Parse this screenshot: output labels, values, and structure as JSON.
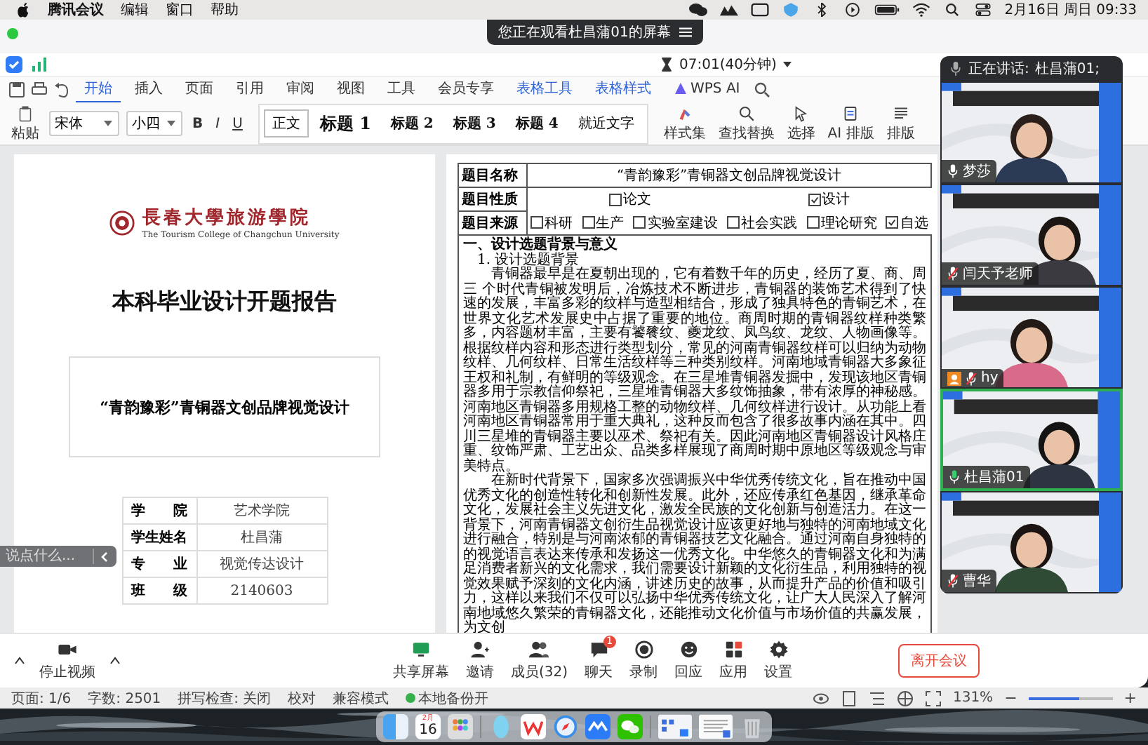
{
  "menubar": {
    "app": "腾讯会议",
    "menus": [
      "编辑",
      "窗口",
      "帮助"
    ],
    "clock": "2月16日 周日 09:33"
  },
  "share_banner": "您正在观看杜昌蒲01的屏幕",
  "meeting_timer": "07:01(40分钟)",
  "ribbon": {
    "tabs": [
      {
        "label": "开始",
        "selected": true,
        "kind": "normal"
      },
      {
        "label": "插入",
        "selected": false,
        "kind": "normal"
      },
      {
        "label": "页面",
        "selected": false,
        "kind": "normal"
      },
      {
        "label": "引用",
        "selected": false,
        "kind": "normal"
      },
      {
        "label": "审阅",
        "selected": false,
        "kind": "normal"
      },
      {
        "label": "视图",
        "selected": false,
        "kind": "normal"
      },
      {
        "label": "工具",
        "selected": false,
        "kind": "normal"
      },
      {
        "label": "会员专享",
        "selected": false,
        "kind": "normal"
      },
      {
        "label": "表格工具",
        "selected": false,
        "kind": "contextual"
      },
      {
        "label": "表格样式",
        "selected": false,
        "kind": "contextual"
      },
      {
        "label": "WPS AI",
        "selected": false,
        "kind": "ai"
      }
    ],
    "paste": "粘贴",
    "font": "宋体",
    "size": "小四",
    "format_buttons": [
      "B",
      "I",
      "U"
    ],
    "styles": [
      {
        "label": "正文",
        "selected": true
      },
      {
        "label": "标题 1",
        "selected": false
      },
      {
        "label": "标题 2",
        "selected": false
      },
      {
        "label": "标题 3",
        "selected": false
      },
      {
        "label": "标题 4",
        "selected": false
      },
      {
        "label": "就近文字",
        "selected": false
      }
    ],
    "tools": [
      {
        "label": "样式集",
        "kind": "styles"
      },
      {
        "label": "查找替换",
        "kind": "find"
      },
      {
        "label": "选择",
        "kind": "select"
      },
      {
        "label": "AI 排版",
        "kind": "ai"
      },
      {
        "label": "排版",
        "kind": "layout"
      }
    ]
  },
  "cover_page": {
    "school": "長春大學旅游學院",
    "school_en": "The Tourism College of Changchun University",
    "title": "本科毕业设计开题报告",
    "project": "“青韵豫彩”青铜器文创品牌视觉设计",
    "info": [
      {
        "label": "学　　院",
        "value": "艺术学院"
      },
      {
        "label": "学生姓名",
        "value": "杜昌蒲"
      },
      {
        "label": "专　　业",
        "value": "视觉传达设计"
      },
      {
        "label": "班　　级",
        "value": "2140603"
      }
    ]
  },
  "proposal_page": {
    "rows": [
      {
        "label": "题目名称",
        "kind": "text",
        "value": "“青韵豫彩”青铜器文创品牌视觉设计"
      },
      {
        "label": "题目性质",
        "kind": "options",
        "options": [
          {
            "label": "论文",
            "checked": false
          },
          {
            "label": "设计",
            "checked": true
          }
        ]
      },
      {
        "label": "题目来源",
        "kind": "options",
        "options": [
          {
            "label": "科研",
            "checked": false
          },
          {
            "label": "生产",
            "checked": false
          },
          {
            "label": "实验室建设",
            "checked": false
          },
          {
            "label": "社会实践",
            "checked": false
          },
          {
            "label": "理论研究",
            "checked": false
          },
          {
            "label": "自选",
            "checked": true
          }
        ]
      }
    ],
    "body": [
      {
        "kind": "heading",
        "text": "一、设计选题背景与意义"
      },
      {
        "kind": "subheading",
        "text": "1. 设计选题背景"
      },
      {
        "kind": "paragraph",
        "text": "青铜器最早是在夏朝出现的，它有着数千年的历史，经历了夏、商、周三 个时代青铜被发明后，冶炼技术不断进步，青铜器的装饰艺术得到了快速的发展，丰富多彩的纹样与造型相结合，形成了独具特色的青铜艺术，在世界文化艺术发展史中占据了重要的地位。商周时期的青铜器纹样种类繁多，内容题材丰富，主要有饕餮纹、夔龙纹、凤鸟纹、龙纹、人物画像等。根据纹样内容和形态进行类型划分，常见的河南青铜器纹样可以归纳为动物纹样、几何纹样、日常生活纹样等三种类别纹样。河南地域青铜器大多象征王权和礼制，有鲜明的等级观念。在三星堆青铜器发掘中，发现该地区青铜器多用于宗教信仰祭祀，三星堆青铜器大多纹饰抽象，带有浓厚的神秘感。河南地区青铜器多用规格工整的动物纹样、几何纹样进行设计。从功能上看河南地区青铜器常用于重大典礼，这种反而包含了很多故事内涵在其中。四川三星堆的青铜器主要以巫术、祭祀有关。因此河南地区青铜器设计风格庄重、纹饰严肃、工艺出众、品类多样展现了商周时期中原地区等级观念与审美特点。"
      },
      {
        "kind": "paragraph",
        "text": "在新时代背景下，国家多次强调振兴中华优秀传统文化，旨在推动中国优秀文化的创造性转化和创新性发展。此外，还应传承红色基因，继承革命文化，发展社会主义先进文化，激发全民族的文化创新与创造活力。在这一背景下，河南青铜器文创衍生品视觉设计应该更好地与独特的河南地域文化进行融合，特别是与河南浓郁的青铜器技艺文化融合。通过河南自身独特的的视觉语言表达来传承和发扬这一优秀文化。中华悠久的青铜器文化和为满足消费者新兴的文化需求，我们需要设计新颖的文化衍生品，利用独特的视觉效果赋予深刻的文化内涵，讲述历史的故事，从而提升产品的价值和吸引力，这样以来我们不仅可以弘扬中华优秀传统文化，让广大人民深入了解河南地域悠久繁荣的青铜器文化，还能推动文化价值与市场价值的共赢发展，为文创"
      }
    ]
  },
  "chat_input": {
    "placeholder": "说点什么..."
  },
  "video_panel": {
    "speaking_label": "正在讲话:",
    "speaker": "杜昌蒲01;",
    "participants": [
      {
        "name": "梦莎",
        "muted": false,
        "host": false,
        "speaking": false
      },
      {
        "name": "闫天予老师",
        "muted": true,
        "host": false,
        "speaking": false
      },
      {
        "name": "hy",
        "muted": true,
        "host": true,
        "speaking": false
      },
      {
        "name": "杜昌蒲01",
        "muted": false,
        "host": false,
        "speaking": true
      },
      {
        "name": "曹华",
        "muted": true,
        "host": false,
        "speaking": false
      }
    ]
  },
  "meeting_toolbar": {
    "video": "停止视频",
    "items": [
      {
        "label": "共享屏幕",
        "kind": "share"
      },
      {
        "label": "邀请",
        "kind": "invite"
      },
      {
        "label": "成员(32)",
        "kind": "members"
      },
      {
        "label": "聊天",
        "kind": "chat",
        "badge": "1"
      },
      {
        "label": "录制",
        "kind": "record"
      },
      {
        "label": "回应",
        "kind": "react"
      },
      {
        "label": "应用",
        "kind": "apps"
      },
      {
        "label": "设置",
        "kind": "settings"
      }
    ],
    "leave": "离开会议"
  },
  "status_bar": {
    "items": [
      "页面: 1/6",
      "字数: 2501",
      "拼写检查: 关闭",
      "校对",
      "兼容模式",
      "本地备份开"
    ],
    "zoom": "131%",
    "zoom_out": "−",
    "zoom_in": "+",
    "zoom_slider": {
      "level": 0.6
    }
  },
  "dock": {
    "calendar_month": "2月",
    "calendar_day": "16"
  }
}
